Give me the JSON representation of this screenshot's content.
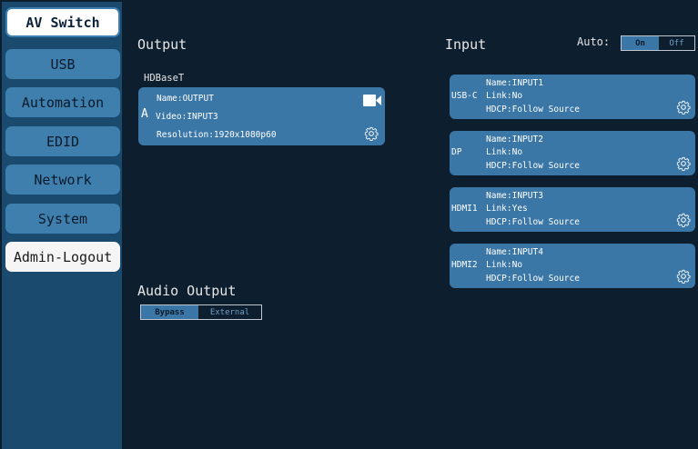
{
  "sidebar": {
    "items": [
      {
        "label": "AV Switch"
      },
      {
        "label": "USB"
      },
      {
        "label": "Automation"
      },
      {
        "label": "EDID"
      },
      {
        "label": "Network"
      },
      {
        "label": "System"
      },
      {
        "label": "Admin-Logout"
      }
    ]
  },
  "output": {
    "title": "Output",
    "port_label": "HDBaseT",
    "card": {
      "prefix": "A",
      "name": "Name:OUTPUT",
      "video": "Video:INPUT3",
      "resolution": "Resolution:1920x1080p60"
    }
  },
  "input": {
    "title": "Input",
    "auto_label": "Auto:",
    "auto_on": "On",
    "auto_off": "Off",
    "cards": [
      {
        "port": "USB-C",
        "name": "Name:INPUT1",
        "link": "Link:No",
        "hdcp": "HDCP:Follow Source"
      },
      {
        "port": "DP",
        "name": "Name:INPUT2",
        "link": "Link:No",
        "hdcp": "HDCP:Follow Source"
      },
      {
        "port": "HDMI1",
        "name": "Name:INPUT3",
        "link": "Link:Yes",
        "hdcp": "HDCP:Follow Source"
      },
      {
        "port": "HDMI2",
        "name": "Name:INPUT4",
        "link": "Link:No",
        "hdcp": "HDCP:Follow Source"
      }
    ]
  },
  "audio": {
    "title": "Audio Output",
    "bypass": "Bypass",
    "external": "External"
  },
  "colors": {
    "background": "#0d1f2f",
    "sidebar": "#1a4a6e",
    "button": "#3f7fae",
    "card": "#3a76a6"
  }
}
